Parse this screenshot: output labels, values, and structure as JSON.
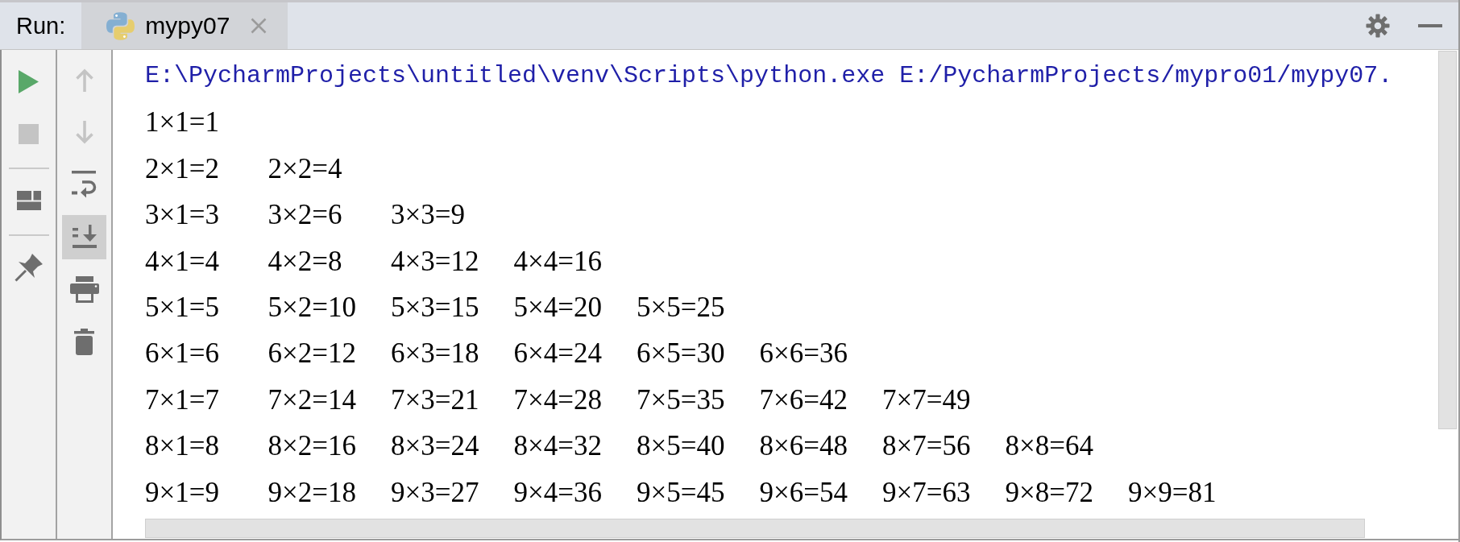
{
  "panel": {
    "title": "Run:"
  },
  "tabs": [
    {
      "label": "mypy07",
      "selected": true
    }
  ],
  "left_toolbar": [
    {
      "kind": "rerun",
      "disabled": false
    },
    {
      "kind": "stop",
      "disabled": true
    },
    {
      "kind": "separator"
    },
    {
      "kind": "layout",
      "disabled": false
    },
    {
      "kind": "separator"
    },
    {
      "kind": "pin",
      "disabled": false
    }
  ],
  "console_toolbar": [
    {
      "kind": "up",
      "disabled": true,
      "on": false
    },
    {
      "kind": "down",
      "disabled": true,
      "on": false
    },
    {
      "kind": "wrap",
      "disabled": false,
      "on": false
    },
    {
      "kind": "scroll_end",
      "disabled": false,
      "on": true
    },
    {
      "kind": "print",
      "disabled": false,
      "on": false
    },
    {
      "kind": "clear",
      "disabled": false,
      "on": false
    }
  ],
  "console": {
    "command": "E:\\PycharmProjects\\untitled\\venv\\Scripts\\python.exe E:/PycharmProjects/mypro01/mypy07.",
    "output": [
      [
        "1×1=1"
      ],
      [
        "2×1=2",
        "2×2=4"
      ],
      [
        "3×1=3",
        "3×2=6",
        "3×3=9"
      ],
      [
        "4×1=4",
        "4×2=8",
        "4×3=12",
        "4×4=16"
      ],
      [
        "5×1=5",
        "5×2=10",
        "5×3=15",
        "5×4=20",
        "5×5=25"
      ],
      [
        "6×1=6",
        "6×2=12",
        "6×3=18",
        "6×4=24",
        "6×5=30",
        "6×6=36"
      ],
      [
        "7×1=7",
        "7×2=14",
        "7×3=21",
        "7×4=28",
        "7×5=35",
        "7×6=42",
        "7×7=49"
      ],
      [
        "8×1=8",
        "8×2=16",
        "8×3=24",
        "8×4=32",
        "8×5=40",
        "8×6=48",
        "8×7=56",
        "8×8=64"
      ],
      [
        "9×1=9",
        "9×2=18",
        "9×3=27",
        "9×4=36",
        "9×5=45",
        "9×6=54",
        "9×7=63",
        "9×8=72",
        "9×9=81"
      ]
    ]
  }
}
